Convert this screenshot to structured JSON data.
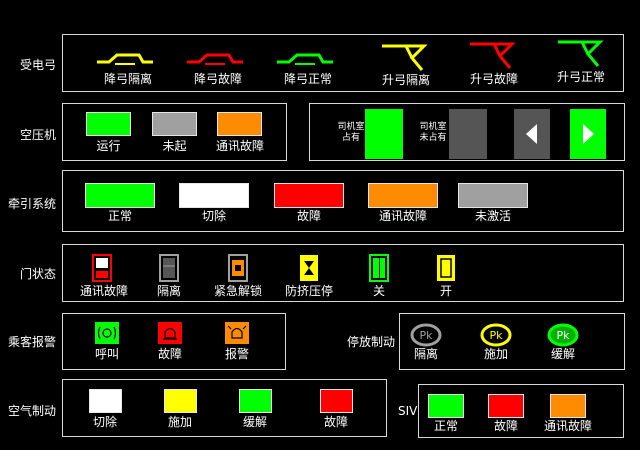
{
  "colors": {
    "green": "#00ff00",
    "red": "#ff0000",
    "orange": "#ff8c00",
    "yellow": "#ffff00",
    "white": "#ffffff",
    "gray": "#a0a0a0",
    "dark_gray": "#555555",
    "frame": "#d8d8d8"
  },
  "pantograph": {
    "title": "受电弓",
    "items": [
      {
        "label": "降弓隔离",
        "color": "#ffff00",
        "icon": "pantograph-lowered-icon"
      },
      {
        "label": "降弓故障",
        "color": "#ff0000",
        "icon": "pantograph-lowered-icon"
      },
      {
        "label": "降弓正常",
        "color": "#00ff00",
        "icon": "pantograph-lowered-icon"
      },
      {
        "label": "升弓隔离",
        "color": "#ffff00",
        "icon": "pantograph-raised-icon"
      },
      {
        "label": "升弓故障",
        "color": "#ff0000",
        "icon": "pantograph-raised-icon"
      },
      {
        "label": "升弓正常",
        "color": "#00ff00",
        "icon": "pantograph-raised-icon"
      }
    ]
  },
  "compressor": {
    "title": "空压机",
    "items": [
      {
        "label": "运行",
        "color": "#00ff00"
      },
      {
        "label": "未起",
        "color": "#a0a0a0"
      },
      {
        "label": "通讯故障",
        "color": "#ff8c00"
      }
    ]
  },
  "cab": {
    "occupied_label": "司机室\n占有",
    "unoccupied_label": "司机室\n未占有",
    "occupied_color": "#00ff00",
    "unoccupied_color": "#555555",
    "left_arrow_icon": "triangle-left-icon",
    "right_arrow_icon": "triangle-right-icon"
  },
  "traction": {
    "title": "牵引系统",
    "items": [
      {
        "label": "正常",
        "color": "#00ff00"
      },
      {
        "label": "切除",
        "color": "#ffffff"
      },
      {
        "label": "故障",
        "color": "#ff0000"
      },
      {
        "label": "通讯故障",
        "color": "#ff8c00"
      },
      {
        "label": "未激活",
        "color": "#a0a0a0"
      }
    ]
  },
  "door": {
    "title": "门状态",
    "items": [
      {
        "label": "通讯故障",
        "color": "#ff0000",
        "icon": "door-comm-fault-icon"
      },
      {
        "label": "隔离",
        "color": "#a0a0a0",
        "icon": "door-isolated-icon"
      },
      {
        "label": "紧急解锁",
        "color": "#ff8c00",
        "icon": "door-emergency-unlock-icon"
      },
      {
        "label": "防挤压停",
        "color": "#ffff00",
        "icon": "door-anti-pinch-icon"
      },
      {
        "label": "关",
        "color": "#00ff00",
        "icon": "door-closed-icon"
      },
      {
        "label": "开",
        "color": "#ffff00",
        "icon": "door-open-icon"
      }
    ]
  },
  "passenger_alarm": {
    "title": "乘客报警",
    "items": [
      {
        "label": "呼叫",
        "color": "#00ff00",
        "icon": "alarm-call-icon"
      },
      {
        "label": "故障",
        "color": "#ff0000",
        "icon": "alarm-fault-icon"
      },
      {
        "label": "报警",
        "color": "#ff8c00",
        "icon": "alarm-alert-icon"
      }
    ]
  },
  "parking_brake": {
    "title": "停放制动",
    "symbol": "Pk",
    "items": [
      {
        "label": "隔离",
        "color": "#a0a0a0"
      },
      {
        "label": "施加",
        "color": "#ffff00"
      },
      {
        "label": "缓解",
        "color": "#00ff00"
      }
    ]
  },
  "air_brake": {
    "title": "空气制动",
    "items": [
      {
        "label": "切除",
        "color": "#ffffff"
      },
      {
        "label": "施加",
        "color": "#ffff00"
      },
      {
        "label": "缓解",
        "color": "#00ff00"
      },
      {
        "label": "故障",
        "color": "#ff0000"
      }
    ]
  },
  "siv": {
    "title": "SIV",
    "items": [
      {
        "label": "正常",
        "color": "#00ff00"
      },
      {
        "label": "故障",
        "color": "#ff0000"
      },
      {
        "label": "通讯故障",
        "color": "#ff8c00"
      }
    ]
  }
}
